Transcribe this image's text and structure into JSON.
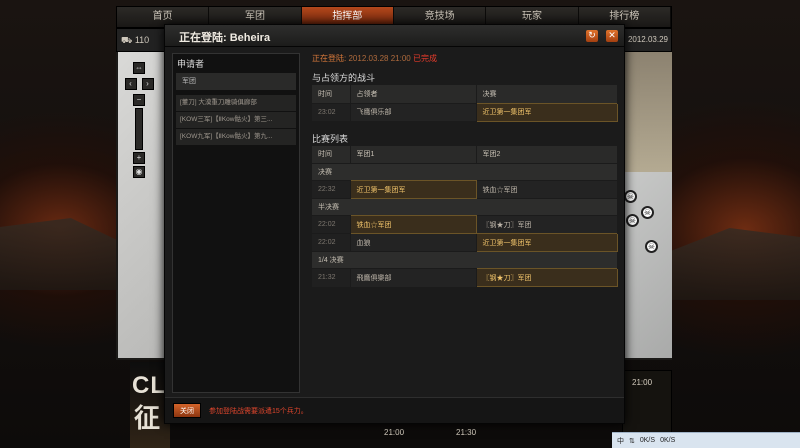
{
  "nav": [
    "首页",
    "军团",
    "指挥部",
    "竞技场",
    "玩家",
    "排行榜"
  ],
  "nav_active": "指挥部",
  "sub_left": "110",
  "sub_right": "9, 2012.03.29",
  "bottom": {
    "clan_word": "CLA",
    "clan_cn": "征",
    "time1": "21:00",
    "time2": "21:00",
    "time3": "21:30",
    "time_right": "21:00",
    "tray": {
      "cn": "中",
      "ok1": "0K/S",
      "ok2": "0K/S"
    }
  },
  "dialog": {
    "title": "正在登陆: Beheira",
    "applicants": {
      "title": "申请者",
      "column": "军团",
      "rows": [
        "[董刀] 大漠重刀雕骑俱廊部",
        "[KOW三军]【ⅡΚow骷火】第三...",
        "[KOW九军]【ⅡΚow骷火】第九..."
      ]
    },
    "status": {
      "label": "正在登陆:",
      "time": "2012.03.28 21:00",
      "state": "已完成"
    },
    "leader_section": {
      "title": "与占领方的战斗",
      "headers": [
        "时间",
        "占领者",
        "决赛"
      ],
      "rows": [
        {
          "time": "23:02",
          "occupier": "飞鹰俱乐部",
          "final": "近卫第一集团军"
        }
      ]
    },
    "matches": {
      "title": "比赛列表",
      "headers": [
        "时间",
        "军团1",
        "军团2"
      ],
      "rounds": [
        {
          "name": "决赛",
          "rows": [
            {
              "time": "22:32",
              "team1": "近卫第一集团军",
              "team2": "铁血☆军团",
              "winner": 1
            }
          ]
        },
        {
          "name": "半决赛",
          "rows": [
            {
              "time": "22:02",
              "team1": "铁血☆军团",
              "team2": "〖钢★刀〗军团",
              "winner": 1
            },
            {
              "time": "22:02",
              "team1": "血狼",
              "team2": "近卫第一集团军",
              "winner": 2
            }
          ]
        },
        {
          "name": "1/4 决赛",
          "rows": [
            {
              "time": "21:32",
              "team1": "飛鷹俱樂部",
              "team2": "〖钢★刀〗军团",
              "winner": 2
            }
          ]
        }
      ]
    },
    "close": "关闭",
    "footer_msg": "参加登陆战需要派遣15个兵力。"
  },
  "colors": {
    "accent": "#c0501f",
    "winner": "#f1c46b",
    "alert": "#e63b2b"
  },
  "icons": [
    "refresh-icon",
    "close-icon",
    "skull-icon",
    "tank-icon"
  ]
}
